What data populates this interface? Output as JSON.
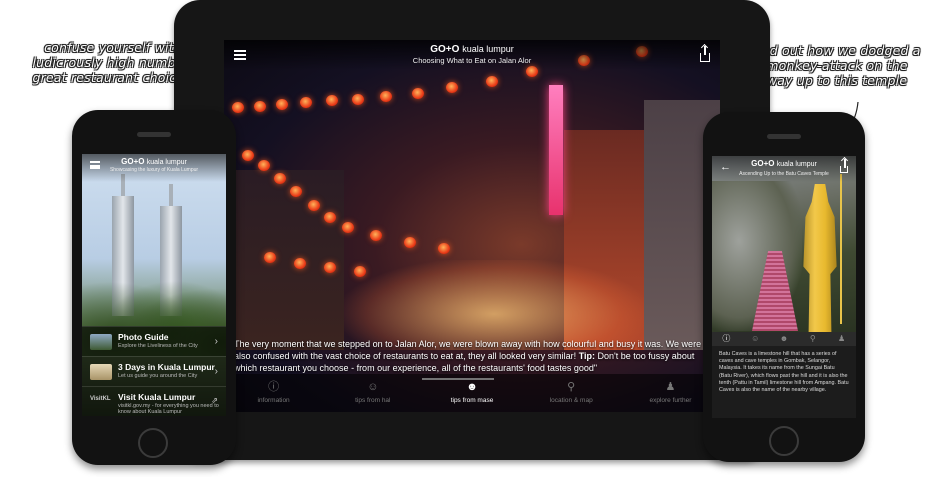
{
  "callouts": {
    "left": "confuse yourself with a ludicrously high number of great restaurant choices !!",
    "right": "find out how we dodged a monkey-attack on the way up to this temple"
  },
  "tablet": {
    "brand": "GO+O",
    "brand_sub": "kuala lumpur",
    "subtitle": "Choosing What to Eat on Jalan Alor",
    "caption_text": "The very moment that we stepped on to Jalan Alor, we were blown away with how colourful and busy it was. We were also confused with the vast choice of restaurants to eat at, they all looked very similar!",
    "caption_tip_label": "Tip:",
    "caption_tip": "Don't be too fussy about which restaurant you choose - from our experience, all of the restaurants' food tastes good\"",
    "tabs": [
      {
        "label": "information",
        "icon": "info-icon"
      },
      {
        "label": "tips from hal",
        "icon": "hal-face-icon"
      },
      {
        "label": "tips from mase",
        "icon": "mase-face-icon"
      },
      {
        "label": "location & map",
        "icon": "map-pin-icon"
      },
      {
        "label": "explore further",
        "icon": "explore-figure-icon"
      }
    ],
    "active_tab": "tips from mase"
  },
  "phone_left": {
    "brand": "GO+O",
    "brand_sub": "kuala lumpur",
    "subtitle": "Showcasing the luxury of Kuala Lumpur",
    "items": [
      {
        "title": "Photo Guide",
        "desc": "Explore the Liveliness of the City",
        "icon": "photo-thumb-icon"
      },
      {
        "title": "3 Days in Kuala Lumpur",
        "desc": "Let us guide you around the City",
        "icon": "map-thumb-icon"
      },
      {
        "title": "Visit Kuala Lumpur",
        "desc": "visitkl.gov.my - for everything you need to know about Kuala Lumpur",
        "icon": "visitkl-logo",
        "badge": "VisitKL"
      }
    ]
  },
  "phone_right": {
    "brand": "GO+O",
    "brand_sub": "kuala lumpur",
    "subtitle": "Ascending Up to the Batu Caves Temple",
    "active_tab": "info-icon",
    "body": "Batu Caves is a limestone hill that has a series of caves and cave temples in Gombak, Selangor, Malaysia. It takes its name from the Sungai Batu (Batu River), which flows past the hill and it is also the tenth (Pattu in Tamil) limestone hill from Ampang. Batu Caves is also the name of the nearby village."
  },
  "colors": {
    "lantern": "#ea3b18",
    "statue_gold": "#e8b92e",
    "device_body": "#161616"
  }
}
